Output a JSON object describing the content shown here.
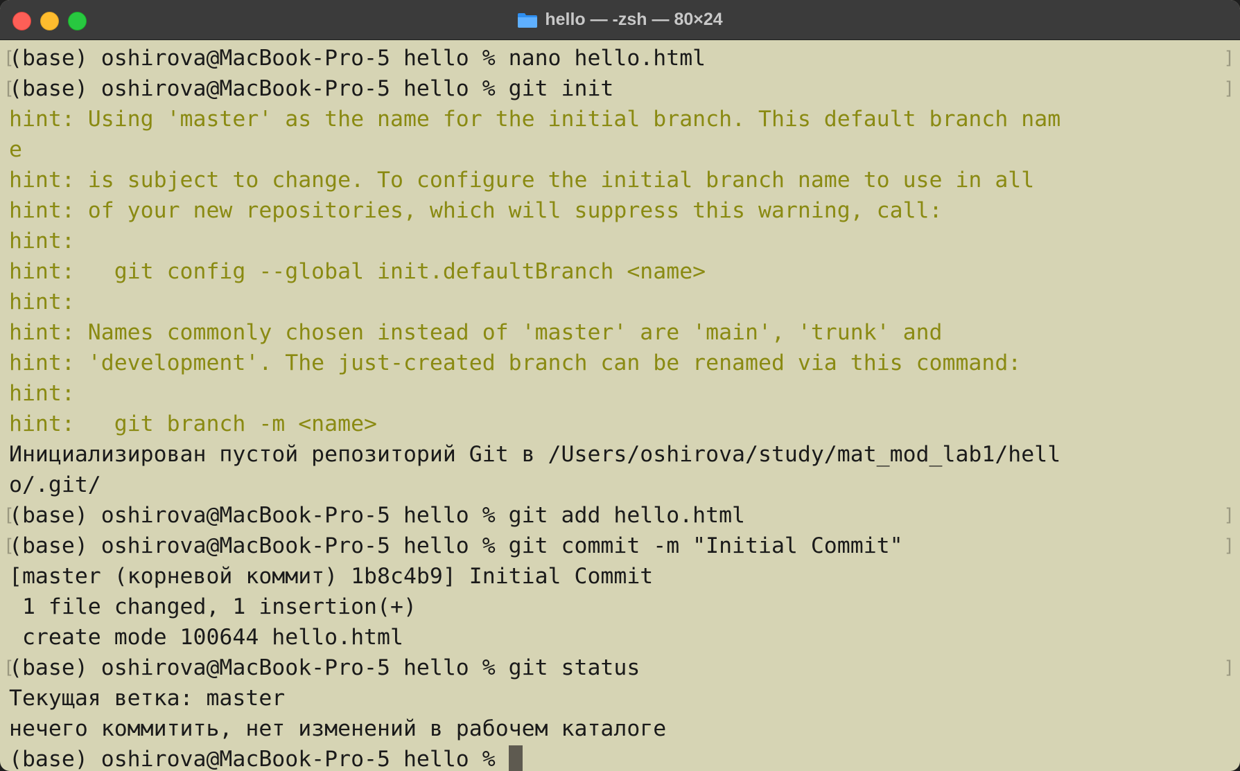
{
  "window": {
    "title": "hello — -zsh — 80×24"
  },
  "terminal": {
    "lines": [
      {
        "kind": "prompt",
        "text": "(base) oshirova@MacBook-Pro-5 hello % nano hello.html"
      },
      {
        "kind": "prompt",
        "text": "(base) oshirova@MacBook-Pro-5 hello % git init"
      },
      {
        "kind": "hint",
        "text": "hint: Using 'master' as the name for the initial branch. This default branch nam"
      },
      {
        "kind": "hint",
        "text": "e"
      },
      {
        "kind": "hint",
        "text": "hint: is subject to change. To configure the initial branch name to use in all"
      },
      {
        "kind": "hint",
        "text": "hint: of your new repositories, which will suppress this warning, call:"
      },
      {
        "kind": "hint",
        "text": "hint:"
      },
      {
        "kind": "hint",
        "text": "hint:   git config --global init.defaultBranch <name>"
      },
      {
        "kind": "hint",
        "text": "hint:"
      },
      {
        "kind": "hint",
        "text": "hint: Names commonly chosen instead of 'master' are 'main', 'trunk' and"
      },
      {
        "kind": "hint",
        "text": "hint: 'development'. The just-created branch can be renamed via this command:"
      },
      {
        "kind": "hint",
        "text": "hint:"
      },
      {
        "kind": "hint",
        "text": "hint:   git branch -m <name>"
      },
      {
        "kind": "output",
        "text": "Инициализирован пустой репозиторий Git в /Users/oshirova/study/mat_mod_lab1/hell"
      },
      {
        "kind": "output",
        "text": "o/.git/"
      },
      {
        "kind": "prompt",
        "text": "(base) oshirova@MacBook-Pro-5 hello % git add hello.html"
      },
      {
        "kind": "prompt",
        "text": "(base) oshirova@MacBook-Pro-5 hello % git commit -m \"Initial Commit\""
      },
      {
        "kind": "output",
        "text": "[master (корневой коммит) 1b8c4b9] Initial Commit"
      },
      {
        "kind": "output",
        "text": " 1 file changed, 1 insertion(+)"
      },
      {
        "kind": "output",
        "text": " create mode 100644 hello.html"
      },
      {
        "kind": "prompt",
        "text": "(base) oshirova@MacBook-Pro-5 hello % git status"
      },
      {
        "kind": "output",
        "text": "Текущая ветка: master"
      },
      {
        "kind": "output",
        "text": "нечего коммитить, нет изменений в рабочем каталоге"
      }
    ],
    "current_prompt": "(base) oshirova@MacBook-Pro-5 hello % "
  },
  "colors": {
    "background": "#d6d4b4",
    "hint": "#8a8a12",
    "text": "#1a1a1a",
    "titlebar": "#3b3b3b"
  },
  "icons": {
    "title": "folder-icon",
    "close": "close-button",
    "minimize": "minimize-button",
    "zoom": "zoom-button"
  }
}
